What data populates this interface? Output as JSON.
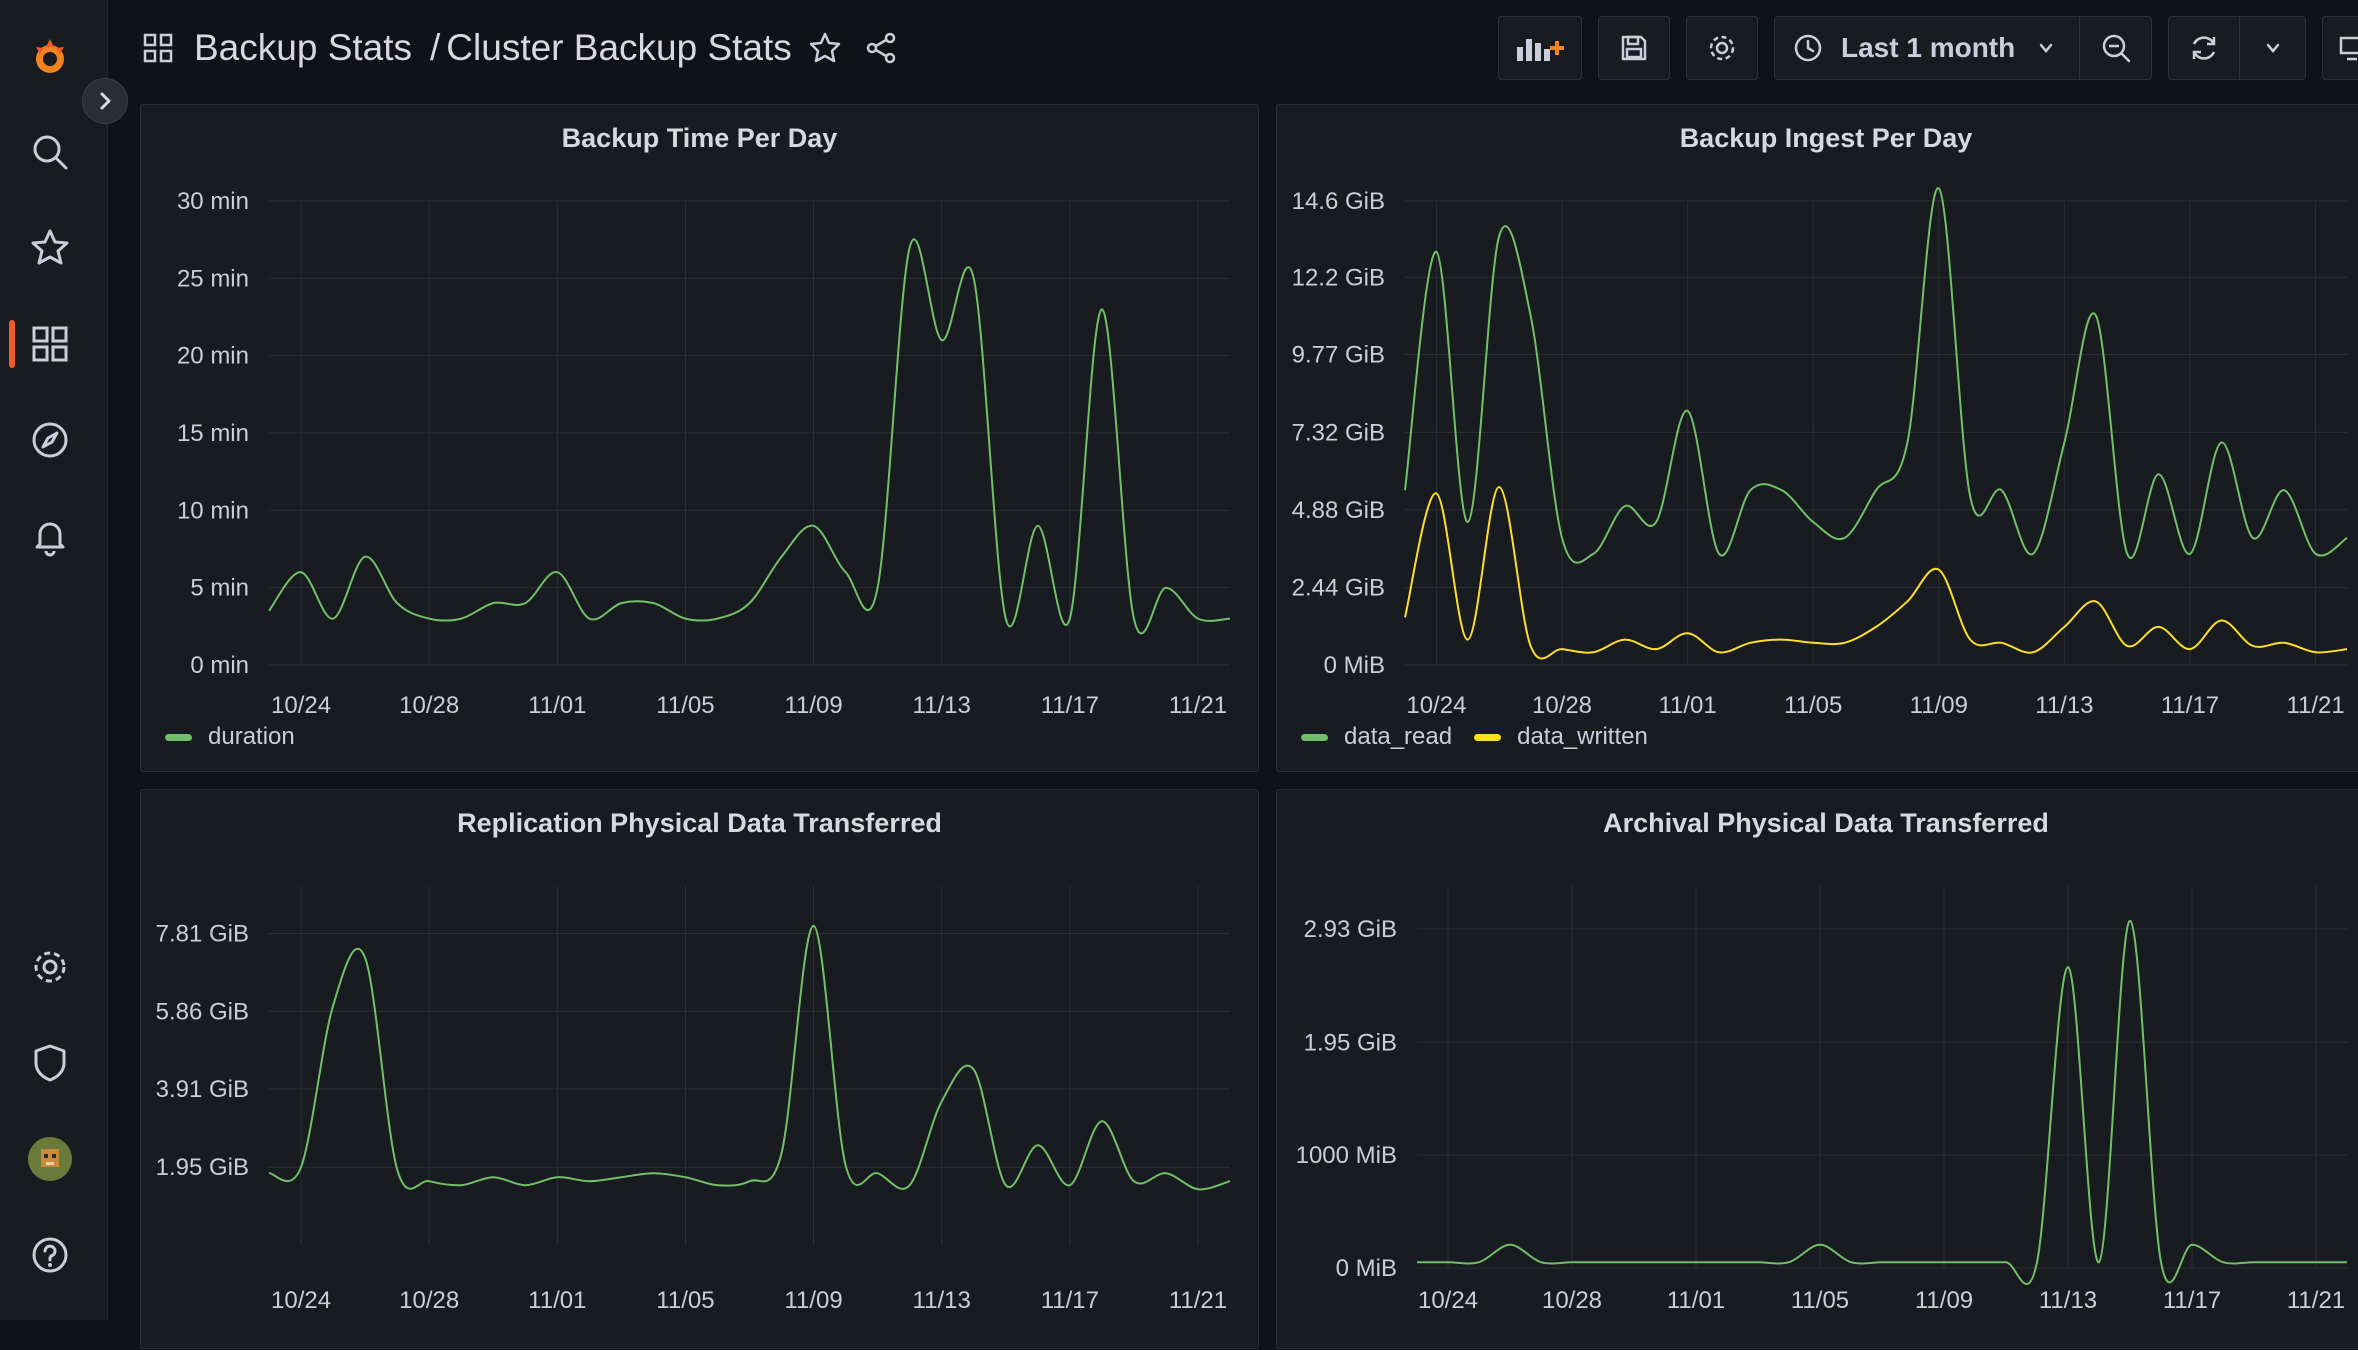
{
  "breadcrumb": {
    "folder": "Backup Stats",
    "separator": "/",
    "dashboard": "Cluster Backup Stats"
  },
  "time_picker": {
    "label": "Last 1 month"
  },
  "sidebar": {
    "icons": [
      "grafana-logo-icon",
      "search-icon",
      "star-icon",
      "dashboards-icon",
      "explore-icon",
      "alerting-icon",
      "configuration-icon",
      "server-admin-icon",
      "avatar",
      "help-icon"
    ]
  },
  "colors": {
    "green": "#73bf69",
    "yellow": "#fade2a",
    "accent": "#f05a28"
  },
  "x_axis_labels": [
    "10/24",
    "10/28",
    "11/01",
    "11/05",
    "11/09",
    "11/13",
    "11/17",
    "11/21"
  ],
  "panels": [
    {
      "title": "Backup Time Per Day",
      "chart_data": {
        "type": "line",
        "title": "Backup Time Per Day",
        "x": [
          "10/23",
          "10/24",
          "10/25",
          "10/26",
          "10/27",
          "10/28",
          "10/29",
          "10/30",
          "10/31",
          "11/01",
          "11/02",
          "11/03",
          "11/04",
          "11/05",
          "11/06",
          "11/07",
          "11/08",
          "11/09",
          "11/10",
          "11/11",
          "11/12",
          "11/13",
          "11/14",
          "11/15",
          "11/16",
          "11/17",
          "11/18",
          "11/19",
          "11/20",
          "11/21",
          "11/22"
        ],
        "yticks": [
          "0 min",
          "5 min",
          "10 min",
          "15 min",
          "20 min",
          "25 min",
          "30 min"
        ],
        "ylim": [
          0,
          30
        ],
        "series": [
          {
            "name": "duration",
            "color": "#73bf69",
            "values": [
              3.5,
              6,
              3,
              7,
              4,
              3,
              3,
              4,
              4,
              6,
              3,
              4,
              4,
              3,
              3,
              4,
              7,
              9,
              6,
              5,
              27,
              21,
              25,
              3,
              9,
              3,
              23,
              3,
              5,
              3,
              3
            ]
          }
        ]
      }
    },
    {
      "title": "Backup Ingest Per Day",
      "chart_data": {
        "type": "line",
        "title": "Backup Ingest Per Day",
        "x": [
          "10/23",
          "10/24",
          "10/25",
          "10/26",
          "10/27",
          "10/28",
          "10/29",
          "10/30",
          "10/31",
          "11/01",
          "11/02",
          "11/03",
          "11/04",
          "11/05",
          "11/06",
          "11/07",
          "11/08",
          "11/09",
          "11/10",
          "11/11",
          "11/12",
          "11/13",
          "11/14",
          "11/15",
          "11/16",
          "11/17",
          "11/18",
          "11/19",
          "11/20",
          "11/21",
          "11/22"
        ],
        "yticks": [
          "0 MiB",
          "2.44 GiB",
          "4.88 GiB",
          "7.32 GiB",
          "9.77 GiB",
          "12.2 GiB",
          "14.6 GiB"
        ],
        "ylim": [
          0,
          14.6
        ],
        "series": [
          {
            "name": "data_read",
            "color": "#73bf69",
            "values": [
              5.5,
              13,
              4.5,
              13.5,
              11,
              4,
              3.5,
              5,
              4.5,
              8,
              3.5,
              5.5,
              5.5,
              4.5,
              4,
              5.5,
              7,
              15,
              5.3,
              5.5,
              3.5,
              7,
              11,
              3.5,
              6,
              3.5,
              7,
              4,
              5.5,
              3.5,
              4
            ]
          },
          {
            "name": "data_written",
            "color": "#fade2a",
            "values": [
              1.5,
              5.4,
              0.8,
              5.6,
              0.6,
              0.5,
              0.4,
              0.8,
              0.5,
              1,
              0.4,
              0.7,
              0.8,
              0.7,
              0.7,
              1.2,
              2,
              3,
              0.8,
              0.7,
              0.4,
              1.2,
              2,
              0.6,
              1.2,
              0.5,
              1.4,
              0.6,
              0.7,
              0.4,
              0.5
            ]
          }
        ]
      }
    },
    {
      "title": "Replication Physical Data Transferred",
      "chart_data": {
        "type": "line",
        "title": "Replication Physical Data Transferred",
        "x": [
          "10/23",
          "10/24",
          "10/25",
          "10/26",
          "10/27",
          "10/28",
          "10/29",
          "10/30",
          "10/31",
          "11/01",
          "11/02",
          "11/03",
          "11/04",
          "11/05",
          "11/06",
          "11/07",
          "11/08",
          "11/09",
          "11/10",
          "11/11",
          "11/12",
          "11/13",
          "11/14",
          "11/15",
          "11/16",
          "11/17",
          "11/18",
          "11/19",
          "11/20",
          "11/21",
          "11/22"
        ],
        "yticks": [
          "1.95 GiB",
          "3.91 GiB",
          "5.86 GiB",
          "7.81 GiB"
        ],
        "ylim": [
          0,
          9
        ],
        "series": [
          {
            "name": "",
            "color": "#73bf69",
            "values": [
              1.8,
              1.95,
              6,
              7.2,
              1.9,
              1.6,
              1.5,
              1.7,
              1.5,
              1.7,
              1.6,
              1.7,
              1.8,
              1.7,
              1.5,
              1.6,
              2.3,
              8,
              2,
              1.8,
              1.5,
              3.6,
              4.4,
              1.5,
              2.5,
              1.5,
              3.1,
              1.6,
              1.8,
              1.4,
              1.6
            ]
          }
        ]
      }
    },
    {
      "title": "Archival Physical Data Transferred",
      "chart_data": {
        "type": "line",
        "title": "Archival Physical Data Transferred",
        "x": [
          "10/23",
          "10/24",
          "10/25",
          "10/26",
          "10/27",
          "10/28",
          "10/29",
          "10/30",
          "10/31",
          "11/01",
          "11/02",
          "11/03",
          "11/04",
          "11/05",
          "11/06",
          "11/07",
          "11/08",
          "11/09",
          "11/10",
          "11/11",
          "11/12",
          "11/13",
          "11/14",
          "11/15",
          "11/16",
          "11/17",
          "11/18",
          "11/19",
          "11/20",
          "11/21",
          "11/22"
        ],
        "yticks": [
          "0 MiB",
          "1000 MiB",
          "1.95 GiB",
          "2.93 GiB"
        ],
        "ylim": [
          0,
          3.3
        ],
        "series": [
          {
            "name": "",
            "color": "#73bf69",
            "values": [
              0.05,
              0.05,
              0.05,
              0.2,
              0.05,
              0.05,
              0.05,
              0.05,
              0.05,
              0.05,
              0.05,
              0.05,
              0.05,
              0.2,
              0.05,
              0.05,
              0.05,
              0.05,
              0.05,
              0.05,
              0.05,
              2.6,
              0.05,
              3,
              0.05,
              0.2,
              0.05,
              0.05,
              0.05,
              0.05,
              0.05
            ]
          }
        ]
      }
    }
  ]
}
